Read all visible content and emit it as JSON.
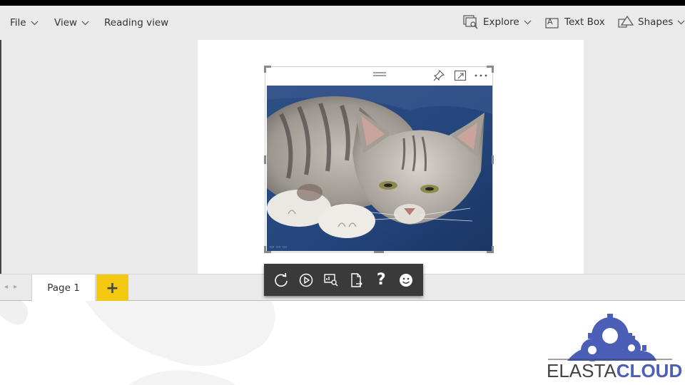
{
  "ribbon": {
    "file": "File",
    "view": "View",
    "reading_view": "Reading view",
    "explore": "Explore",
    "text_box": "Text Box",
    "shapes": "Shapes"
  },
  "tabs": {
    "page1": "Page 1",
    "add": "+"
  },
  "toolbar": {
    "help": "?"
  },
  "logo": {
    "part1": "ELASTA",
    "part2": "CLOUD"
  },
  "colors": {
    "accent_yellow": "#f2c811",
    "logo_blue": "#4a5fb5"
  }
}
